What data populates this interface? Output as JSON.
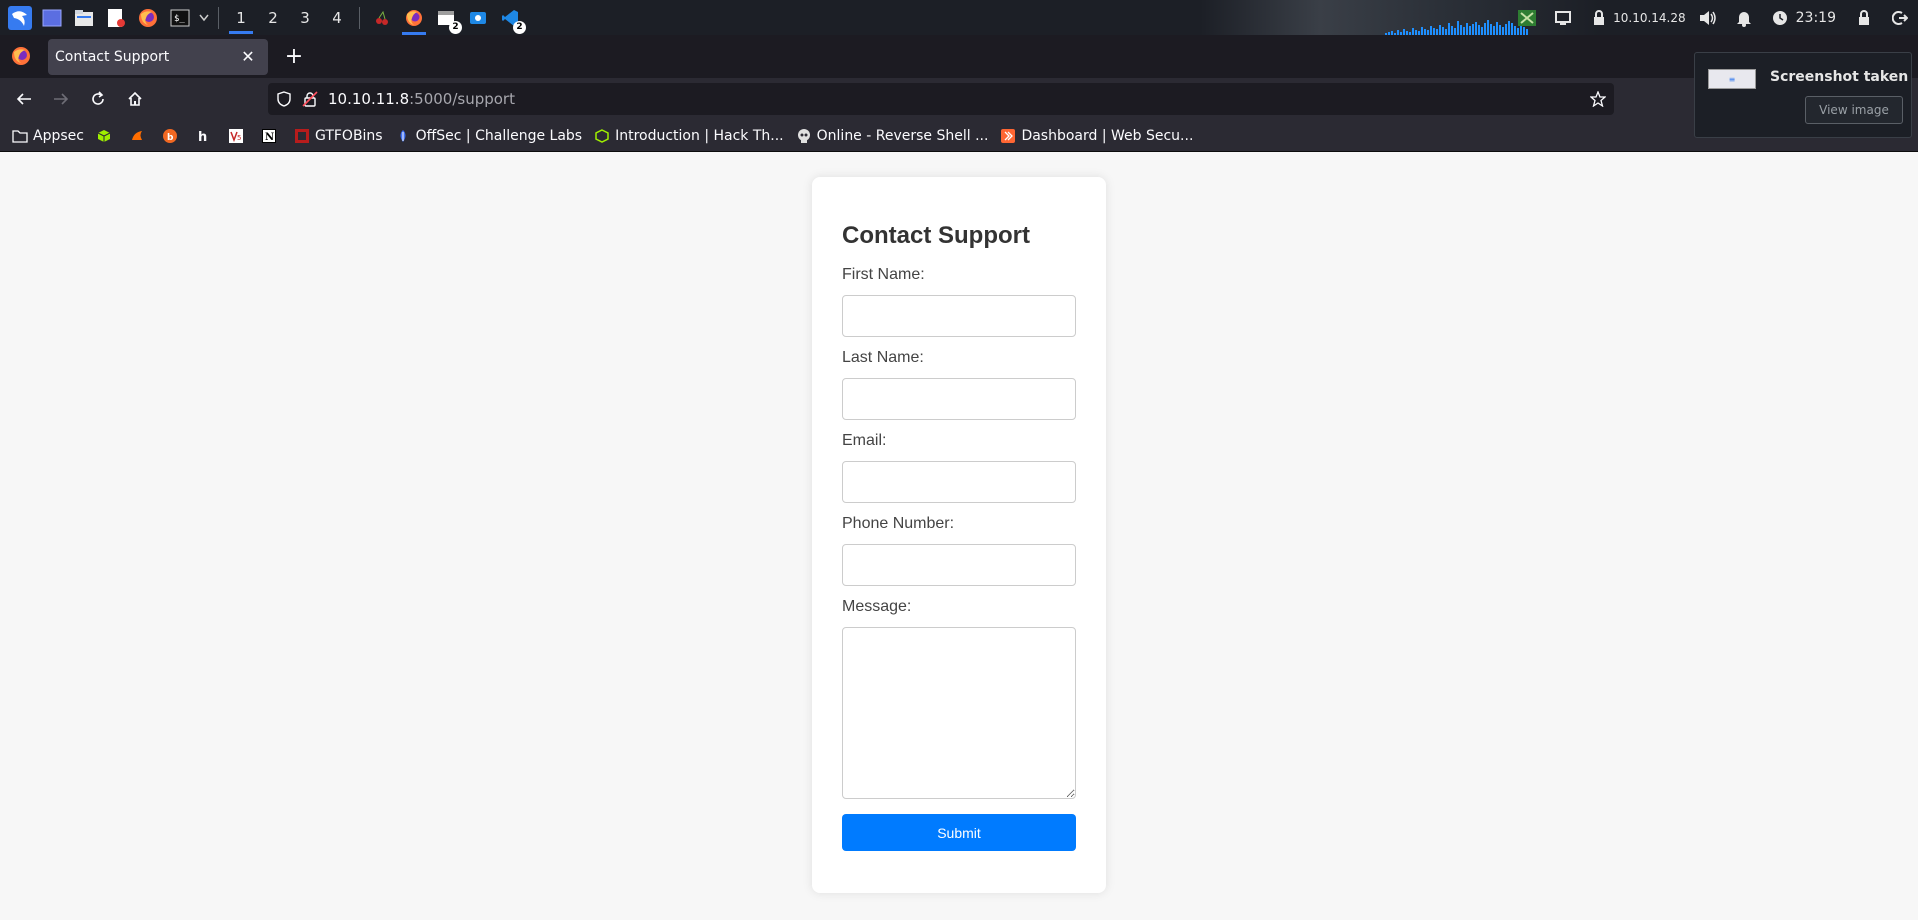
{
  "taskbar": {
    "workspaces": [
      "1",
      "2",
      "3",
      "4"
    ],
    "active_workspace": "1",
    "window_badges": [
      "2",
      "2"
    ],
    "tray": {
      "ip_address": "10.10.14.28",
      "clock": "23:19"
    }
  },
  "browser": {
    "tab": {
      "title": "Contact Support"
    },
    "url": {
      "host": "10.10.11.8",
      "path": ":5000/support"
    },
    "bookmarks": [
      {
        "label": "Appsec"
      },
      {
        "label": ""
      },
      {
        "label": ""
      },
      {
        "label": ""
      },
      {
        "label": ""
      },
      {
        "label": ""
      },
      {
        "label": ""
      },
      {
        "label": "GTFOBins"
      },
      {
        "label": "OffSec | Challenge Labs"
      },
      {
        "label": "Introduction | Hack Th..."
      },
      {
        "label": "Online - Reverse Shell ..."
      },
      {
        "label": "Dashboard | Web Secu..."
      }
    ]
  },
  "form": {
    "title": "Contact Support",
    "first_name_label": "First Name:",
    "first_name_value": "",
    "last_name_label": "Last Name:",
    "last_name_value": "",
    "email_label": "Email:",
    "email_value": "",
    "phone_label": "Phone Number:",
    "phone_value": "",
    "message_label": "Message:",
    "message_value": "",
    "submit_label": "Submit"
  },
  "notification": {
    "title": "Screenshot taken",
    "button": "View image"
  },
  "colors": {
    "accent": "#367bf0",
    "submit": "#007bff",
    "page_background": "#f7f7f7"
  }
}
